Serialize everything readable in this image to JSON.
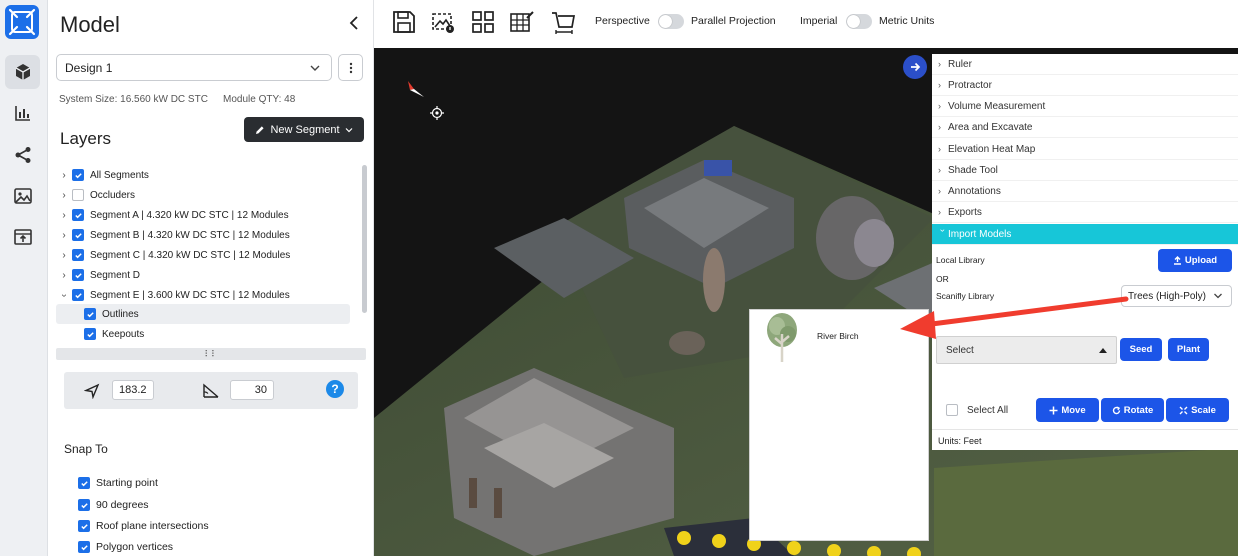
{
  "panel": {
    "title": "Model",
    "design_selected": "Design 1",
    "system_size": "System Size: 16.560 kW DC STC",
    "module_qty": "Module QTY: 48",
    "layers_title": "Layers",
    "new_segment_label": "New Segment"
  },
  "layers": [
    {
      "label": "All Segments",
      "checked": true,
      "caret": "right"
    },
    {
      "label": "Occluders",
      "checked": false,
      "caret": "right"
    },
    {
      "label": "Segment A | 4.320 kW DC STC | 12 Modules",
      "checked": true,
      "caret": "right"
    },
    {
      "label": "Segment B | 4.320 kW DC STC | 12 Modules",
      "checked": true,
      "caret": "right"
    },
    {
      "label": "Segment C | 4.320 kW DC STC | 12 Modules",
      "checked": true,
      "caret": "right"
    },
    {
      "label": "Segment D",
      "checked": true,
      "caret": "right"
    },
    {
      "label": "Segment E | 3.600 kW DC STC | 12 Modules",
      "checked": true,
      "caret": "down"
    },
    {
      "label": "Outlines",
      "checked": true,
      "caret": "none"
    },
    {
      "label": "Keepouts",
      "checked": true,
      "caret": "none"
    }
  ],
  "angles": {
    "azimuth": "183.2",
    "tilt": "30",
    "help": "?"
  },
  "snap": {
    "title": "Snap To",
    "items": [
      "Starting point",
      "90 degrees",
      "Roof plane intersections",
      "Polygon vertices"
    ]
  },
  "toolbar": {
    "perspective": "Perspective",
    "parallel": "Parallel Projection",
    "imperial": "Imperial",
    "metric": "Metric Units"
  },
  "tools": {
    "items": [
      "Ruler",
      "Protractor",
      "Volume Measurement",
      "Area and Excavate",
      "Elevation Heat Map",
      "Shade Tool",
      "Annotations",
      "Exports",
      "Import Models"
    ],
    "active": "Import Models",
    "local_library": "Local Library",
    "upload": "Upload",
    "or": "OR",
    "scanifly_library": "Scanifly Library",
    "library_selected": "Trees (High-Poly)",
    "model_select": "Select",
    "seed": "Seed",
    "plant": "Plant",
    "select_all": "Select All",
    "move": "Move",
    "rotate": "Rotate",
    "scale": "Scale",
    "units": "Units: Feet"
  },
  "dropdown": {
    "items": [
      "River Birch"
    ]
  },
  "colors": {
    "accent": "#1c55e8",
    "active_tool": "#17c6d8",
    "annotation_arrow": "#f03c2e"
  }
}
